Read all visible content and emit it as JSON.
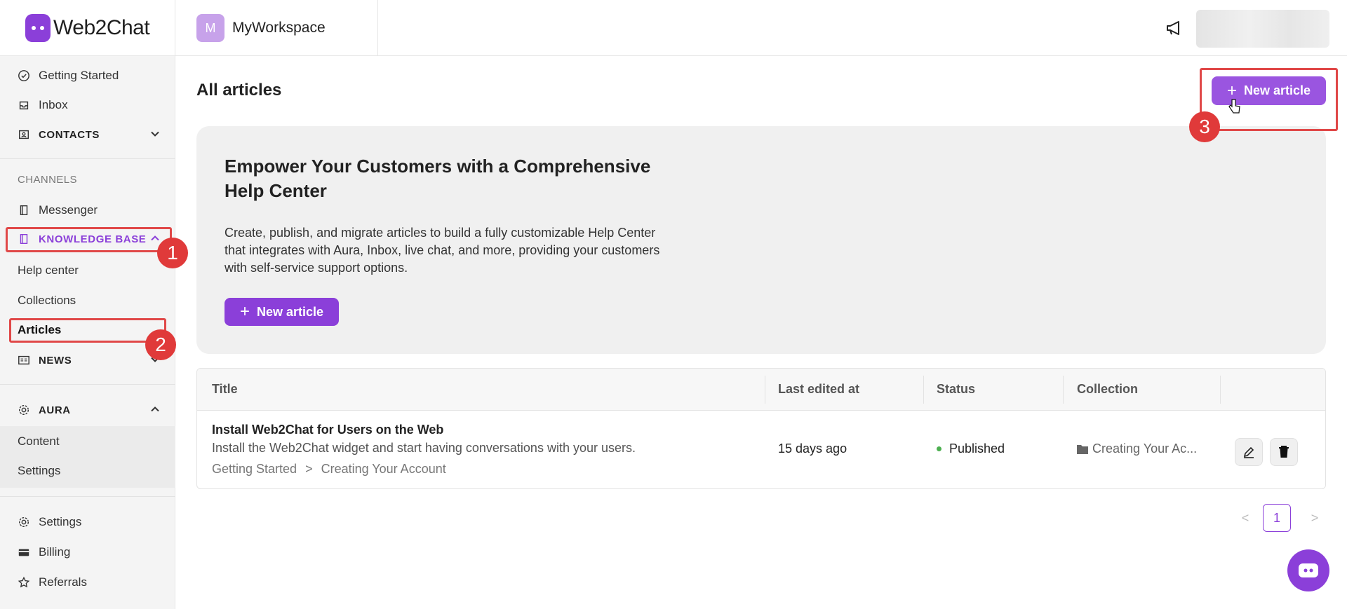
{
  "brand": {
    "name": "Web2Chat"
  },
  "workspace": {
    "initial": "M",
    "name": "MyWorkspace"
  },
  "sidebar": {
    "getting_started": "Getting Started",
    "inbox": "Inbox",
    "contacts": "CONTACTS",
    "channels_section": "CHANNELS",
    "messenger": "Messenger",
    "knowledge_base": "KNOWLEDGE BASE",
    "help_center": "Help center",
    "collections": "Collections",
    "articles": "Articles",
    "news": "NEWS",
    "aura": "AURA",
    "aura_content": "Content",
    "aura_settings": "Settings",
    "settings": "Settings",
    "billing": "Billing",
    "referrals": "Referrals"
  },
  "main": {
    "title": "All articles",
    "new_article_label": "New article"
  },
  "hero": {
    "heading": "Empower Your Customers with a Comprehensive Help Center",
    "body": "Create, publish, and migrate articles to build a fully customizable Help Center that integrates with Aura, Inbox, live chat, and more, providing your customers with self-service support options.",
    "button_label": "New article"
  },
  "table": {
    "headers": [
      "Title",
      "Last edited at",
      "Status",
      "Collection"
    ],
    "rows": [
      {
        "title": "Install Web2Chat for Users on the Web",
        "description": "Install the Web2Chat widget and start having conversations with your users.",
        "crumb_parent": "Getting Started",
        "crumb_sep": ">",
        "crumb_child": "Creating Your Account",
        "last_edited": "15 days ago",
        "status": "Published",
        "collection": "Creating Your Ac..."
      }
    ]
  },
  "pagination": {
    "current": "1",
    "prev": "<",
    "next": ">"
  },
  "annotations": {
    "one": "1",
    "two": "2",
    "three": "3"
  },
  "colors": {
    "accent": "#8b3fd9",
    "highlight": "#e04848",
    "published": "#4caf50"
  }
}
